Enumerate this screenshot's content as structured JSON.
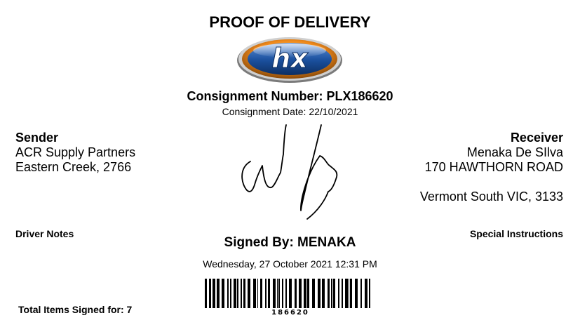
{
  "document": {
    "title": "PROOF OF DELIVERY"
  },
  "logo": {
    "text": "hx",
    "icon": "hx-brand-logo"
  },
  "consignment": {
    "number_label": "Consignment Number: PLX186620",
    "date_label": "Consignment Date: 22/10/2021"
  },
  "sender": {
    "heading": "Sender",
    "name": "ACR Supply Partners",
    "location": "Eastern Creek, 2766"
  },
  "receiver": {
    "heading": "Receiver",
    "name": "Menaka De SIlva",
    "address1": "170 HAWTHORN ROAD",
    "address2": "Vermont South VIC, 3133"
  },
  "notes": {
    "driver_notes_label": "Driver Notes",
    "special_instructions_label": "Special Instructions"
  },
  "signature": {
    "signed_by": "Signed By: MENAKA",
    "datetime": "Wednesday, 27 October 2021 12:31 PM"
  },
  "items": {
    "total_label": "Total Items Signed for: 7"
  },
  "barcode": {
    "value": "186620"
  },
  "colors": {
    "logo_blue": "#1a4f9c",
    "logo_orange": "#f08a1c",
    "ink": "#000000"
  }
}
